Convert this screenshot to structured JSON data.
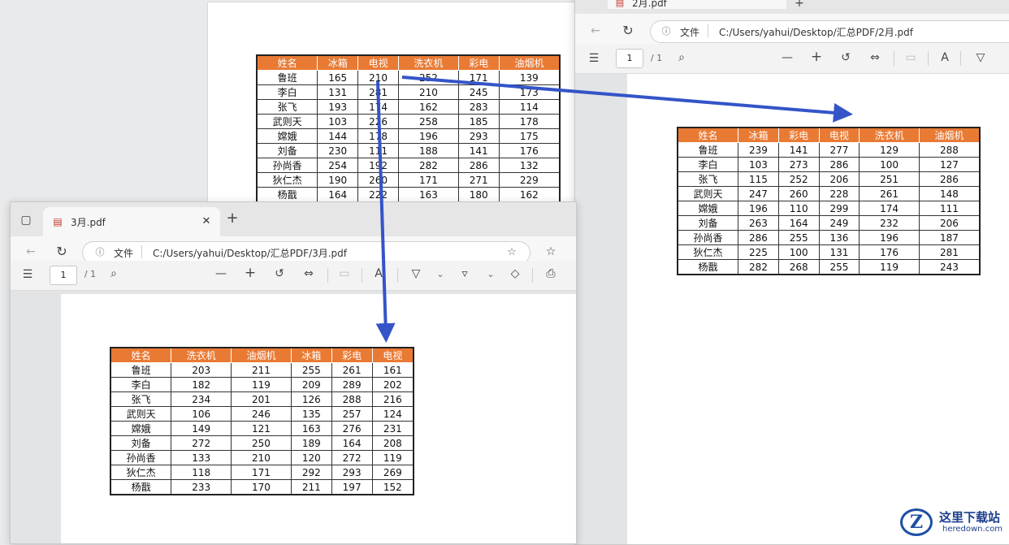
{
  "colors": {
    "header_bg": "#e97a34",
    "arrow": "#3454c8"
  },
  "background_table": {
    "headers": [
      "姓名",
      "冰箱",
      "电视",
      "洗衣机",
      "彩电",
      "油烟机"
    ],
    "rows": [
      [
        "鲁班",
        "165",
        "210",
        "252",
        "171",
        "139"
      ],
      [
        "李白",
        "131",
        "281",
        "210",
        "245",
        "173"
      ],
      [
        "张飞",
        "193",
        "174",
        "162",
        "283",
        "114"
      ],
      [
        "武则天",
        "103",
        "226",
        "258",
        "185",
        "178"
      ],
      [
        "嫦娥",
        "144",
        "178",
        "196",
        "293",
        "175"
      ],
      [
        "刘备",
        "230",
        "111",
        "188",
        "141",
        "176"
      ],
      [
        "孙尚香",
        "254",
        "192",
        "282",
        "286",
        "132"
      ],
      [
        "狄仁杰",
        "190",
        "260",
        "171",
        "271",
        "229"
      ],
      [
        "杨戬",
        "164",
        "222",
        "163",
        "180",
        "162"
      ]
    ]
  },
  "right_window": {
    "tab_title": "2月.pdf",
    "address_label": "文件",
    "address": "C:/Users/yahui/Desktop/汇总PDF/2月.pdf",
    "page_current": "1",
    "page_total": "/ 1",
    "table": {
      "headers": [
        "姓名",
        "冰箱",
        "彩电",
        "电视",
        "洗衣机",
        "油烟机"
      ],
      "rows": [
        [
          "鲁班",
          "239",
          "141",
          "277",
          "129",
          "288"
        ],
        [
          "李白",
          "103",
          "273",
          "286",
          "100",
          "127"
        ],
        [
          "张飞",
          "115",
          "252",
          "206",
          "251",
          "286"
        ],
        [
          "武则天",
          "247",
          "260",
          "228",
          "261",
          "148"
        ],
        [
          "嫦娥",
          "196",
          "110",
          "299",
          "174",
          "111"
        ],
        [
          "刘备",
          "263",
          "164",
          "249",
          "232",
          "206"
        ],
        [
          "孙尚香",
          "286",
          "255",
          "136",
          "196",
          "187"
        ],
        [
          "狄仁杰",
          "225",
          "100",
          "131",
          "176",
          "281"
        ],
        [
          "杨戬",
          "282",
          "268",
          "255",
          "119",
          "243"
        ]
      ]
    }
  },
  "left_window": {
    "tab_title": "3月.pdf",
    "address_label": "文件",
    "address": "C:/Users/yahui/Desktop/汇总PDF/3月.pdf",
    "page_current": "1",
    "page_total": "/ 1",
    "table": {
      "headers": [
        "姓名",
        "洗衣机",
        "油烟机",
        "冰箱",
        "彩电",
        "电视"
      ],
      "rows": [
        [
          "鲁班",
          "203",
          "211",
          "255",
          "261",
          "161"
        ],
        [
          "李白",
          "182",
          "119",
          "209",
          "289",
          "202"
        ],
        [
          "张飞",
          "234",
          "201",
          "126",
          "288",
          "216"
        ],
        [
          "武则天",
          "106",
          "246",
          "135",
          "257",
          "124"
        ],
        [
          "嫦娥",
          "149",
          "121",
          "163",
          "276",
          "231"
        ],
        [
          "刘备",
          "272",
          "250",
          "189",
          "164",
          "208"
        ],
        [
          "孙尚香",
          "133",
          "210",
          "120",
          "272",
          "119"
        ],
        [
          "狄仁杰",
          "118",
          "171",
          "292",
          "293",
          "269"
        ],
        [
          "杨戬",
          "233",
          "170",
          "211",
          "197",
          "152"
        ]
      ]
    }
  },
  "watermark": {
    "text": "这里下载站",
    "url": "heredown.com",
    "logo": "Z"
  }
}
